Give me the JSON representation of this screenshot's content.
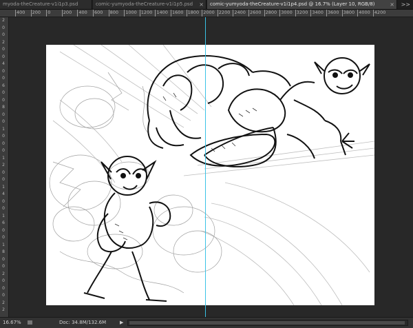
{
  "tabs": [
    {
      "label": "myoda-theCreature-v1i1p3.psd",
      "close": "×"
    },
    {
      "label": "comic-yumyoda-theCreature-v1i1p5.psd",
      "close": "×"
    },
    {
      "label": "comic-yumyoda-theCreature-v1i1p4.psd @ 16.7% (Layer 10, RGB/8)",
      "close": "×",
      "active": true
    }
  ],
  "tab_overflow": ">>",
  "ruler_h_labels": [
    "400",
    "200",
    "0",
    "200",
    "400",
    "600",
    "800",
    "1000",
    "1200",
    "1400",
    "1600",
    "1800",
    "2000",
    "2200",
    "2400",
    "2600",
    "2800",
    "3000",
    "3200",
    "3400",
    "3600",
    "3800",
    "4000",
    "4200"
  ],
  "ruler_v_labels": [
    "2",
    "0",
    "0",
    "2",
    "0",
    "0",
    "4",
    "0",
    "0",
    "6",
    "0",
    "0",
    "8",
    "0",
    "0",
    "1",
    "0",
    "0",
    "0",
    "1",
    "2",
    "0",
    "0",
    "1",
    "4",
    "0",
    "0",
    "1",
    "6",
    "0",
    "0",
    "1",
    "8",
    "0",
    "0",
    "2",
    "0",
    "0",
    "0",
    "2",
    "2"
  ],
  "status": {
    "zoom": "16.67%",
    "doc": "Doc: 34.8M/132.6M",
    "arrow": "▶"
  },
  "colors": {
    "guide": "#39c3e6",
    "canvas_bg": "#282828",
    "artboard": "#ffffff"
  }
}
